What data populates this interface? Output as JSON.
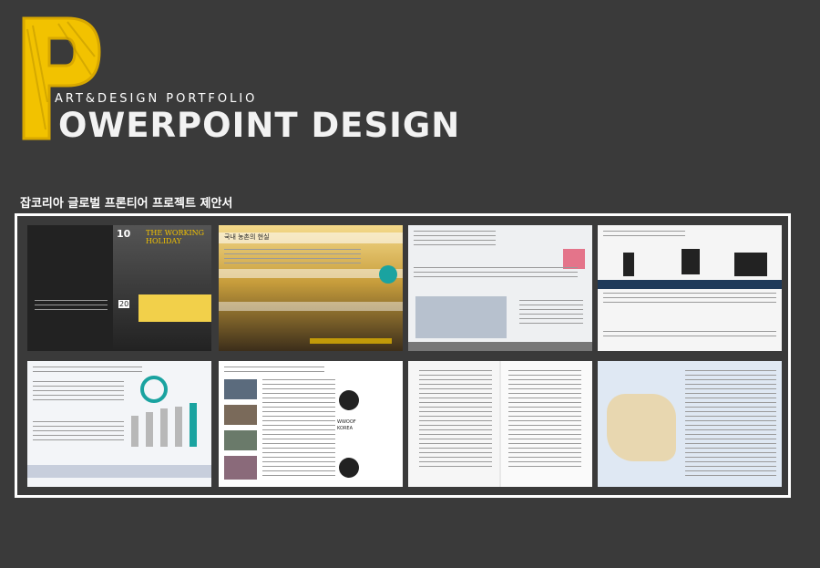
{
  "header": {
    "logo_letter": "P",
    "subtitle": "ART&DESIGN PORTFOLIO",
    "title": "OWERPOINT DESIGN"
  },
  "section": {
    "title": "잡코리아 글로벌 프론티어 프로젝트 제안서"
  },
  "slides": {
    "s1": {
      "issue": "10",
      "magazine": "THE WORKING HOLIDAY",
      "badge": "20"
    },
    "s2": {
      "header": "국내 농촌의 현실"
    },
    "s6": {
      "badge": "WWOOF KOREA"
    }
  },
  "colors": {
    "background": "#3a3a3a",
    "accent_yellow": "#f2c200",
    "teal": "#1aa3a0"
  }
}
